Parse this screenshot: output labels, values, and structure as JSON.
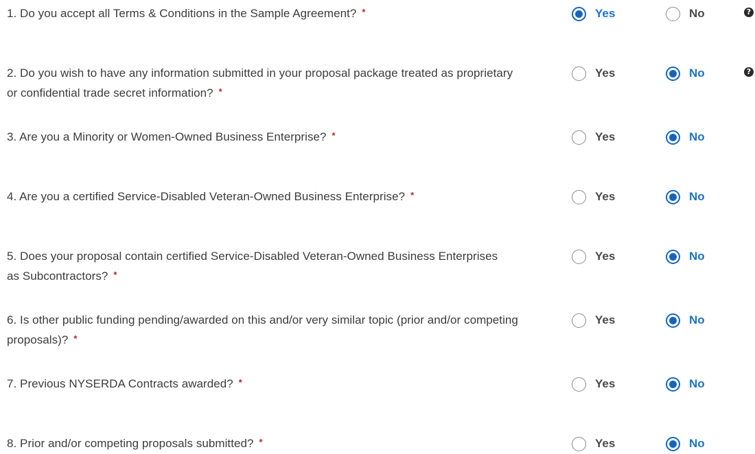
{
  "questions": [
    {
      "text": "1. Do you accept all Terms & Conditions in the Sample Agreement?",
      "required_mark": "*",
      "yes_label": "Yes",
      "no_label": "No",
      "selected": "yes",
      "help": "?",
      "help_icon": "question-circle-icon"
    },
    {
      "text": "2. Do you wish to have any information submitted in your proposal package treated as proprietary or confidential trade secret information?",
      "required_mark": "*",
      "yes_label": "Yes",
      "no_label": "No",
      "selected": "no",
      "help": "?",
      "help_icon": "question-circle-icon"
    },
    {
      "text": "3. Are you a Minority or Women-Owned Business Enterprise?",
      "required_mark": "*",
      "yes_label": "Yes",
      "no_label": "No",
      "selected": "no"
    },
    {
      "text": "4. Are you a certified Service-Disabled Veteran-Owned Business Enterprise?",
      "required_mark": "*",
      "yes_label": "Yes",
      "no_label": "No",
      "selected": "no"
    },
    {
      "text": "5. Does your proposal contain certified Service-Disabled Veteran-Owned Business Enterprises as Subcontractors?",
      "required_mark": "*",
      "yes_label": "Yes",
      "no_label": "No",
      "selected": "no"
    },
    {
      "text": "6. Is other public funding pending/awarded on this and/or very similar topic (prior and/or competing proposals)?",
      "required_mark": "*",
      "yes_label": "Yes",
      "no_label": "No",
      "selected": "no"
    },
    {
      "text": "7. Previous NYSERDA Contracts awarded?",
      "required_mark": "*",
      "yes_label": "Yes",
      "no_label": "No",
      "selected": "no"
    },
    {
      "text": "8. Prior and/or competing proposals submitted?",
      "required_mark": "*",
      "yes_label": "Yes",
      "no_label": "No",
      "selected": "no"
    }
  ],
  "colors": {
    "accent": "#1565c0",
    "required": "#b3262b",
    "text": "#3c3c3c"
  }
}
